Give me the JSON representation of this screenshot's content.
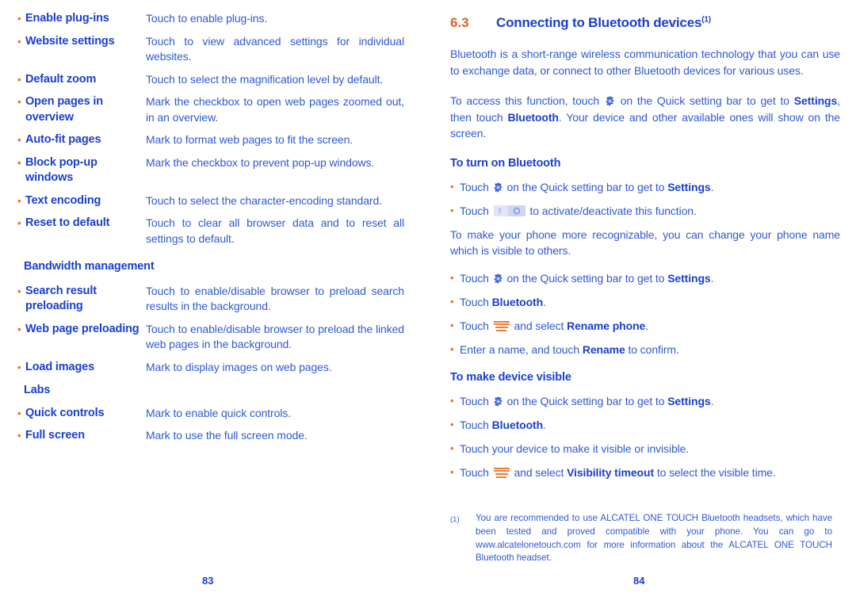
{
  "colors": {
    "body_blue": "#2f59d4",
    "bold_blue": "#1a3fcd",
    "bullet_orange": "#ee7533",
    "chapter_orange": "#ee5a24",
    "page_background": "#ffffff"
  },
  "left_page": {
    "folio": "83",
    "settings_rows": [
      {
        "bullet": "•",
        "term": "Enable plug-ins",
        "description": "Touch to enable plug-ins.",
        "justify": false
      },
      {
        "bullet": "•",
        "term": "Website settings",
        "description": "Touch to view advanced settings for individual websites.",
        "justify": true
      },
      {
        "bullet": "•",
        "term": "Default zoom",
        "description": "Touch to select the magnification level by default.",
        "justify": false
      },
      {
        "bullet": "•",
        "term": "Open pages in overview",
        "description": "Mark the checkbox to open web pages zoomed out, in an overview.",
        "justify": true
      },
      {
        "bullet": "•",
        "term": "Auto-fit pages",
        "description": "Mark to format web pages to fit the screen.",
        "justify": false
      },
      {
        "bullet": "•",
        "term": "Block pop-up windows",
        "description": "Mark the checkbox to prevent pop-up windows.",
        "justify": false
      },
      {
        "bullet": "•",
        "term": "Text encoding",
        "description": "Touch to select the character-encoding standard.",
        "justify": false
      },
      {
        "bullet": "•",
        "term": "Reset to default",
        "description": "Touch to clear all browser data and to reset all settings to default.",
        "justify": true
      }
    ],
    "bandwidth_heading": "Bandwidth management",
    "bandwidth_rows": [
      {
        "bullet": "•",
        "term": "Search result preloading",
        "description": "Touch to enable/disable browser to preload search results in the background.",
        "justify": true
      },
      {
        "bullet": "•",
        "term": "Web page preloading",
        "description": "Touch to enable/disable browser to preload the linked web pages in the background.",
        "justify": true
      },
      {
        "bullet": "•",
        "term": "Load images",
        "description": "Mark to display images on web pages.",
        "justify": false
      }
    ],
    "labs_heading": "Labs",
    "labs_rows": [
      {
        "bullet": "•",
        "term": "Quick controls",
        "description": "Mark to enable quick controls.",
        "justify": false
      },
      {
        "bullet": "•",
        "term": "Full screen",
        "description": "Mark to use the full screen mode.",
        "justify": false
      }
    ]
  },
  "right_page": {
    "folio": "84",
    "chapter": {
      "number": "6.3",
      "title": "Connecting to Bluetooth devices",
      "footnote_marker": "(1)"
    },
    "intro_paragraph": "Bluetooth is a short-range wireless communication technology that you can use to exchange data, or connect to other Bluetooth devices for various uses.",
    "access_paragraph": {
      "part1": "To access this function, touch ",
      "icon": "gear-icon",
      "part2": " on the Quick setting bar to get to ",
      "bold1": "Settings",
      "part3": ", then touch ",
      "bold2": "Bluetooth",
      "part4": ". Your device and other available ones will show on the screen."
    },
    "turn_on_section": {
      "heading": "To turn on Bluetooth",
      "items": [
        {
          "bullet": "•",
          "part1": "Touch ",
          "icon": "gear-icon",
          "part2": " on the Quick setting bar to get to ",
          "bold1": "Settings",
          "part3": "."
        },
        {
          "bullet": "•",
          "part1": "Touch ",
          "icon": "toggle-switch-icon",
          "part2": " to activate/deactivate this function.",
          "bold1": "",
          "part3": ""
        }
      ]
    },
    "rename_paragraph": "To make your phone more recognizable, you can change your phone name which is visible to others.",
    "rename_items": [
      {
        "bullet": "•",
        "part1": "Touch ",
        "icon": "gear-icon",
        "part2": " on the Quick setting bar to get to ",
        "bold1": "Settings",
        "part3": "."
      },
      {
        "bullet": "•",
        "part1": "Touch ",
        "icon": "",
        "part2": "",
        "bold1": "Bluetooth",
        "part3": "."
      },
      {
        "bullet": "•",
        "part1": "Touch ",
        "icon": "menu-icon",
        "part2": " and select ",
        "bold1": "Rename phone",
        "part3": "."
      },
      {
        "bullet": "•",
        "part1": "Enter a name, and touch ",
        "icon": "",
        "part2": "",
        "bold1": "Rename",
        "part3": " to confirm."
      }
    ],
    "visible_section": {
      "heading": "To make device visible",
      "items": [
        {
          "bullet": "•",
          "part1": "Touch ",
          "icon": "gear-icon",
          "part2": " on the Quick setting bar to get to ",
          "bold1": "Settings",
          "part3": "."
        },
        {
          "bullet": "•",
          "part1": "Touch ",
          "icon": "",
          "part2": "",
          "bold1": "Bluetooth",
          "part3": "."
        },
        {
          "bullet": "•",
          "part1": "Touch your device to make it visible or invisible.",
          "icon": "",
          "part2": "",
          "bold1": "",
          "part3": ""
        },
        {
          "bullet": "•",
          "part1": "Touch ",
          "icon": "menu-icon",
          "part2": " and select ",
          "bold1": "Visibility timeout",
          "part3": " to select the visible time."
        }
      ]
    },
    "footnote": {
      "marker": "(1)",
      "text": "You are recommended to use ALCATEL ONE TOUCH Bluetooth headsets, which have been tested and proved compatible with your phone. You can go to www.alcatelonetouch.com for more information about the ALCATEL ONE TOUCH Bluetooth headset."
    }
  }
}
